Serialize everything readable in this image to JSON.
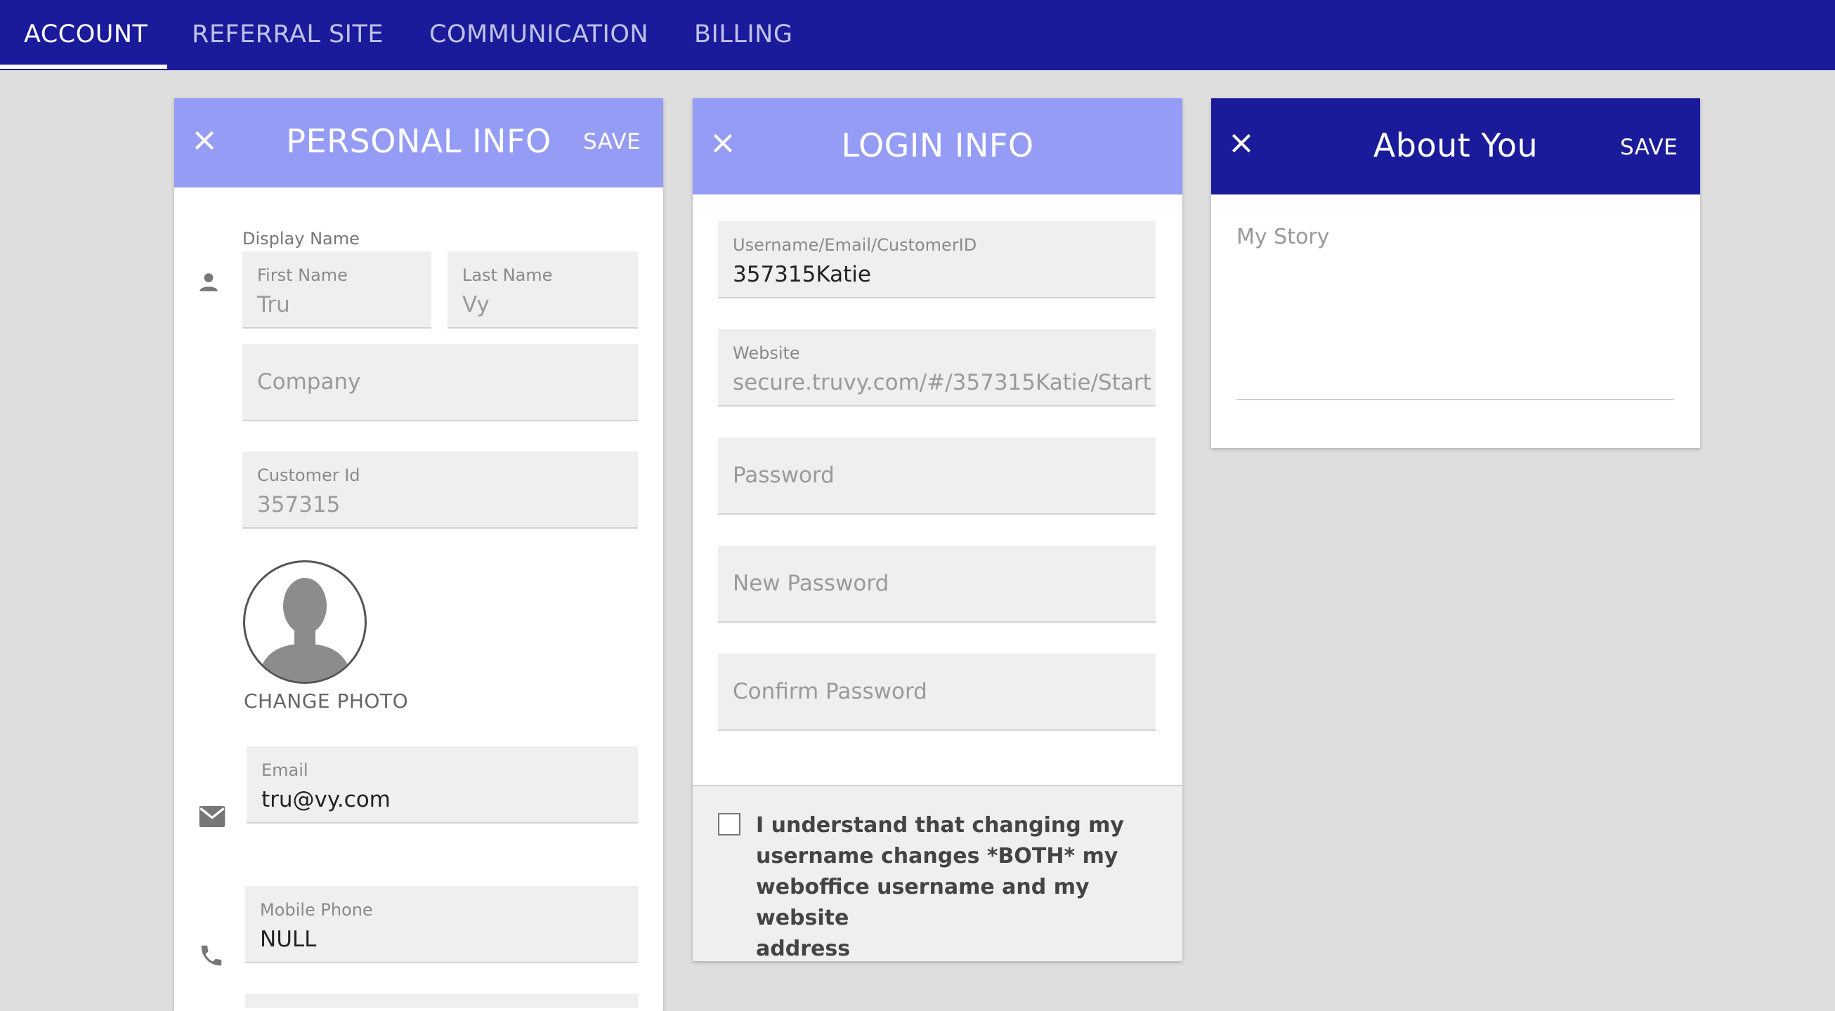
{
  "colors": {
    "topbar": "#1a1b9a",
    "header_light": "#959cf5",
    "header_dark": "#1a1b9a",
    "field_bg": "#efefef"
  },
  "tabs": [
    {
      "label": "ACCOUNT",
      "active": true
    },
    {
      "label": "REFERRAL SITE",
      "active": false
    },
    {
      "label": "COMMUNICATION",
      "active": false
    },
    {
      "label": "BILLING",
      "active": false
    }
  ],
  "personal_info": {
    "title": "PERSONAL INFO",
    "save_label": "SAVE",
    "close_icon": "close-icon",
    "display_name_label": "Display Name",
    "first_name": {
      "label": "First Name",
      "value": "Tru"
    },
    "last_name": {
      "label": "Last Name",
      "value": "Vy"
    },
    "company": {
      "placeholder": "Company"
    },
    "customer_id": {
      "label": "Customer Id",
      "value": "357315"
    },
    "change_photo_label": "CHANGE PHOTO",
    "email": {
      "label": "Email",
      "value": "tru@vy.com"
    },
    "mobile_phone": {
      "label": "Mobile Phone",
      "value": "NULL"
    }
  },
  "login_info": {
    "title": "LOGIN INFO",
    "close_icon": "close-icon",
    "username": {
      "label": "Username/Email/CustomerID",
      "value": "357315Katie"
    },
    "website": {
      "label": "Website",
      "value": "secure.truvy.com/#/357315Katie/Start"
    },
    "password": {
      "placeholder": "Password"
    },
    "new_password": {
      "placeholder": "New Password"
    },
    "confirm_password": {
      "placeholder": "Confirm Password"
    },
    "notice_lines": [
      "I understand that changing my",
      "username changes *BOTH* my",
      "weboffice username and my website",
      "address"
    ]
  },
  "about_you": {
    "title": "About You",
    "save_label": "SAVE",
    "close_icon": "close-icon",
    "story_label": "My Story"
  }
}
